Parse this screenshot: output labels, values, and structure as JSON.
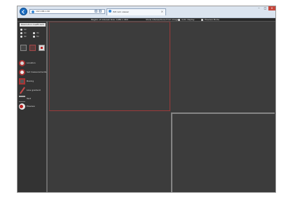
{
  "browser": {
    "address_text": "192.168.1.90",
    "tab_label": "ISP cam viewer",
    "tab_close": "×",
    "window_controls": [
      "–",
      "□",
      "×"
    ]
  },
  "app_header": {
    "dimensions_text": "Region of Interest Size: 1280 x 960",
    "show_text": "Show intersections from image",
    "checkbox_1_label": "Auto display",
    "checkbox_2_label": "Preview Mode"
  },
  "sidebar": {
    "size_title": "Resolution Coefficient",
    "size_options": [
      "1x",
      "2x",
      "3x",
      "4x",
      "5x",
      "6x"
    ],
    "tools": [
      {
        "icon": "circle-icon",
        "label": "Location"
      },
      {
        "icon": "target-icon",
        "label": "Set measurements"
      },
      {
        "icon": "rectangle-icon",
        "label": "Boxing"
      },
      {
        "icon": "line-icon",
        "label": "Line gradient"
      },
      {
        "icon": "text-icon",
        "label": "Text"
      },
      {
        "icon": "eye-icon",
        "label": "Preview"
      }
    ]
  },
  "colors": {
    "accent_red": "#a33333",
    "canvas_bg": "#3c3c3c",
    "chrome_bg": "#dbe4ef"
  }
}
